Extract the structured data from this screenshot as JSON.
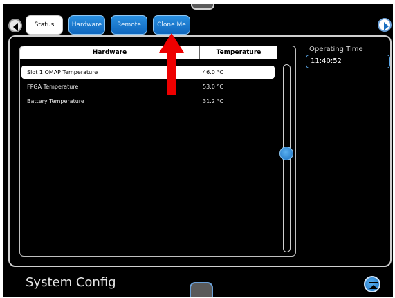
{
  "tabs": {
    "status": "Status",
    "hardware": "Hardware",
    "remote": "Remote",
    "clone_me": "Clone Me",
    "active": "status"
  },
  "table": {
    "headers": {
      "hardware": "Hardware",
      "temperature": "Temperature"
    },
    "rows": [
      {
        "name": "Slot 1 OMAP Temperature",
        "temperature": "46.0 °C",
        "selected": true
      },
      {
        "name": "FPGA Temperature",
        "temperature": "53.0 °C",
        "selected": false
      },
      {
        "name": "Battery Temperature",
        "temperature": "31.2 °C",
        "selected": false
      }
    ]
  },
  "operating_time": {
    "label": "Operating Time",
    "value": "11:40:52"
  },
  "footer": {
    "title": "System Config"
  },
  "icons": {
    "back": "back-arrow-icon",
    "forward": "forward-arrow-icon",
    "menu": "menu-up-icon",
    "annotation": "red-arrow-icon"
  },
  "colors": {
    "accent": "#1a6fc0",
    "annotation": "#ee0000"
  }
}
